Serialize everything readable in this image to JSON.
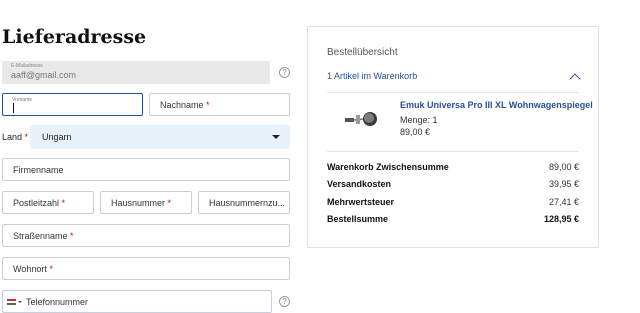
{
  "page": {
    "title": "Lieferadresse"
  },
  "form": {
    "email": {
      "small_label": "E-Mailadresse",
      "value": "aaff@gmail.com"
    },
    "vorname": {
      "small_label": "Vorname"
    },
    "nachname": {
      "label": "Nachname",
      "required_mark": "*"
    },
    "land": {
      "label": "Land",
      "required_mark": "*",
      "value": "Ungarn"
    },
    "firmenname": {
      "label": "Firmenname"
    },
    "postleitzahl": {
      "label": "Postleitzahl",
      "required_mark": "*"
    },
    "hausnummer": {
      "label": "Hausnummer",
      "required_mark": "*"
    },
    "hausnummernzusatz": {
      "label": "Hausnummernzu..."
    },
    "strassenname": {
      "label": "Straßenname",
      "required_mark": "*"
    },
    "wohnort": {
      "label": "Wohnort",
      "required_mark": "*"
    },
    "telefon": {
      "label": "Telefonnummer",
      "flag": "flag-hungary-icon"
    },
    "help_glyph": "?"
  },
  "summary": {
    "title": "Bestellübersicht",
    "item_count_label": "1 Artikel im Warenkorb",
    "product": {
      "name": "Emuk Universa Pro III XL Wohnwagenspiegel",
      "quantity": "Menge: 1",
      "price": "89,00 €"
    },
    "rows": [
      {
        "label": "Warenkorb Zwischensumme",
        "amount": "89,00 €"
      },
      {
        "label": "Versandkosten",
        "amount": "39,95 €"
      },
      {
        "label": "Mehrwertsteuer",
        "amount": "27,41 €"
      },
      {
        "label": "Bestellsumme",
        "amount": "128,95 €"
      }
    ]
  },
  "colors": {
    "accent": "#2a4f94",
    "required": "#d0021b",
    "select_bg": "#e8f2fb"
  }
}
